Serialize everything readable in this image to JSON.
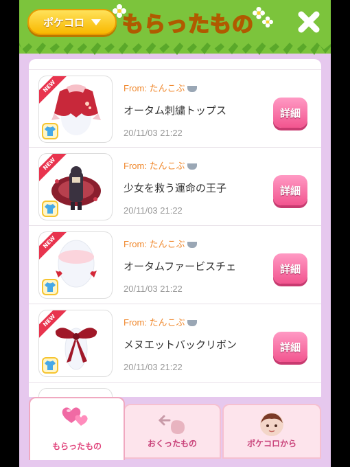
{
  "header": {
    "dropdown_label": "ポケコロ",
    "title": "もらったもの"
  },
  "items": [
    {
      "from": "From: たんこぶ",
      "name": "オータム刺繍トップス",
      "date": "20/11/03 21:22",
      "detail_label": "詳細",
      "badge": "NEW"
    },
    {
      "from": "From: たんこぶ",
      "name": "少女を救う運命の王子",
      "date": "20/11/03 21:22",
      "detail_label": "詳細",
      "badge": "NEW"
    },
    {
      "from": "From: たんこぶ",
      "name": "オータムファービスチェ",
      "date": "20/11/03 21:22",
      "detail_label": "詳細",
      "badge": "NEW"
    },
    {
      "from": "From: たんこぶ",
      "name": "メヌエットバックリボン",
      "date": "20/11/03 21:22",
      "detail_label": "詳細",
      "badge": "NEW"
    }
  ],
  "tabs": [
    {
      "label": "もらったもの",
      "active": true
    },
    {
      "label": "おくったもの",
      "active": false
    },
    {
      "label": "ポケコロから",
      "active": false
    }
  ],
  "colors": {
    "accent_pink": "#f2558f",
    "header_green": "#7cc43c",
    "title_yellow": "#ffd92e",
    "from_orange": "#f08a30",
    "background_lilac": "#e6c8ee"
  },
  "icons": [
    "close-icon",
    "chevron-down-icon",
    "flower-icon",
    "bathtub-icon",
    "shirt-icon",
    "heart-gems-icon",
    "send-back-icon",
    "avatar-icon"
  ]
}
